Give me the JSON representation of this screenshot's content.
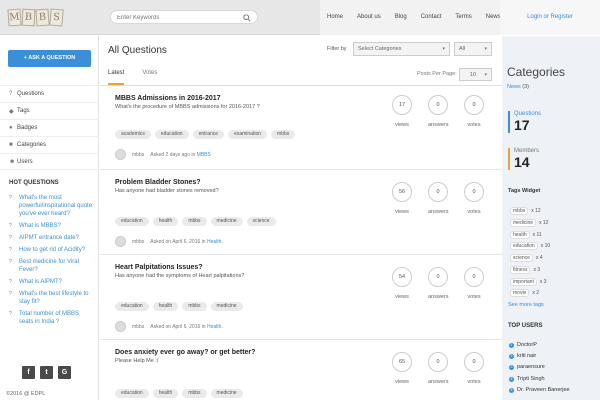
{
  "header": {
    "logo_letters": [
      "M",
      "B",
      "B",
      "S"
    ],
    "search_placeholder": "Enter Keywords",
    "nav": [
      "Home",
      "About us",
      "Blog",
      "Contact",
      "Terms",
      "News"
    ],
    "login_label": "Login or Register"
  },
  "sidebar": {
    "ask_button": "+ ASK A QUESTION",
    "menu": [
      {
        "icon": "question-icon",
        "label": "Questions"
      },
      {
        "icon": "tag-icon",
        "label": "Tags"
      },
      {
        "icon": "badge-icon",
        "label": "Badges"
      },
      {
        "icon": "folder-icon",
        "label": "Categories"
      },
      {
        "icon": "users-icon",
        "label": "Users"
      }
    ],
    "hot_title": "HOT QUESTIONS",
    "hot_questions": [
      "What's the most powerful/inspirational quote you've ever heard?",
      "What is MBBS?",
      "AIPMT entrance date?",
      "How to get rid of Acidity?",
      "Best medicine for Viral Fever?",
      "What is AIPMT?",
      "What's the best lifestyle to stay fit?",
      "Total number of MBBS seats in India ?"
    ],
    "social": [
      "f",
      "t",
      "G"
    ],
    "copyright": "©2016 @ EDPL"
  },
  "main": {
    "title": "All Questions",
    "filter_label": "Filter by",
    "category_select": "Select Categories",
    "all_select": "All",
    "tabs": [
      "Latest",
      "Votes"
    ],
    "posts_per_page_label": "Posts Per Page:",
    "posts_per_page_value": "10",
    "stat_labels": [
      "views",
      "answers",
      "votes"
    ],
    "questions": [
      {
        "title": "MBBS Admissions in 2016-2017",
        "desc": "What's the procedure of MBBS admissions for 2016-2017 ?",
        "tags": [
          "academics",
          "education",
          "entrance",
          "examination",
          "mbbs"
        ],
        "author": "mbbs",
        "asked": "Asked 2 days ago in",
        "category": "MBBS",
        "views": "17",
        "answers": "0",
        "votes": "0"
      },
      {
        "title": "Problem Bladder Stones?",
        "desc": "Has anyone had bladder stones removed?",
        "tags": [
          "education",
          "health",
          "mbbs",
          "medicine",
          "science"
        ],
        "author": "mbbs",
        "asked": "Asked on April 6, 2016 in",
        "category": "Health.",
        "views": "56",
        "answers": "0",
        "votes": "0"
      },
      {
        "title": "Heart Palpitations Issues?",
        "desc": "Has anyone had the symptoms of Heart palpitations?",
        "tags": [
          "education",
          "health",
          "mbbs",
          "medicine"
        ],
        "author": "mbbs",
        "asked": "Asked on April 6, 2016 in",
        "category": "Health.",
        "views": "54",
        "answers": "0",
        "votes": "0"
      },
      {
        "title": "Does anxiety ever go away? or get better?",
        "desc": "Please Help Me :/",
        "tags": [
          "education",
          "health",
          "mbbs",
          "medicine"
        ],
        "author": "",
        "asked": "",
        "category": "",
        "views": "65",
        "answers": "0",
        "votes": "0"
      }
    ]
  },
  "rightbar": {
    "categories_title": "Categories",
    "news_label": "News",
    "news_count": "(3)",
    "questions_label": "Questions",
    "questions_count": "17",
    "members_label": "Members",
    "members_count": "14",
    "tags_widget_title": "Tags Widget",
    "tags": [
      {
        "name": "mbbs",
        "count": "x 12"
      },
      {
        "name": "medicine",
        "count": "x 12"
      },
      {
        "name": "health",
        "count": "x 11"
      },
      {
        "name": "education",
        "count": "x 10"
      },
      {
        "name": "science",
        "count": "x 4"
      },
      {
        "name": "fitness",
        "count": "x 3"
      },
      {
        "name": "important",
        "count": "x 3"
      },
      {
        "name": "movie",
        "count": "x 2"
      }
    ],
    "see_more": "See more tags",
    "top_users_title": "TOP USERS",
    "top_users": [
      "DoctorP",
      "kriti nair",
      "paraensure",
      "Tripti Singh",
      "Dr. Praveen Banerjee"
    ]
  },
  "colors": {
    "accent": "#3a8fd8",
    "orange": "#f0a030"
  }
}
